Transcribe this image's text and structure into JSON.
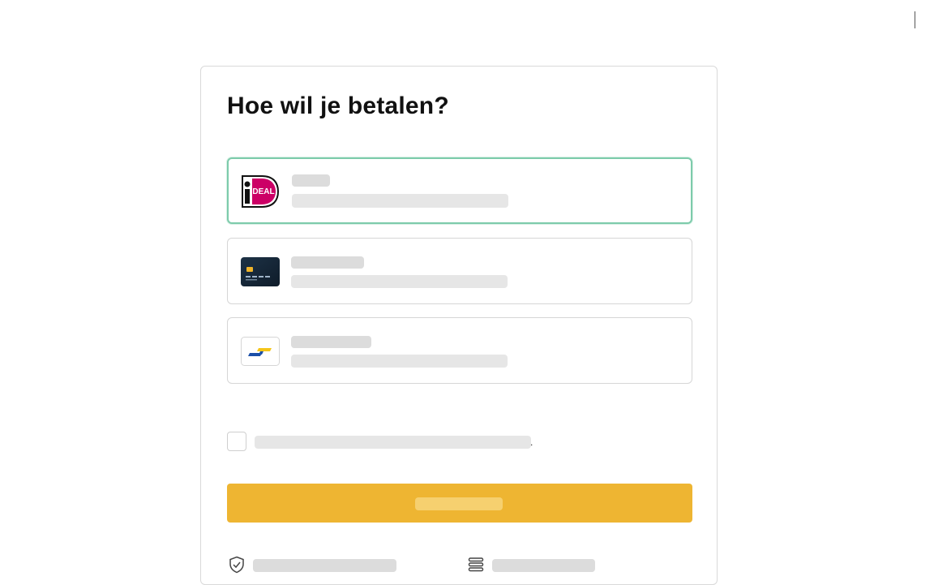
{
  "page": {
    "title": "Hoe wil je betalen?"
  },
  "payment_options": [
    {
      "id": "ideal",
      "icon": "ideal-logo-icon",
      "selected": true
    },
    {
      "id": "card",
      "icon": "credit-card-icon",
      "selected": false
    },
    {
      "id": "transfer",
      "icon": "bank-transfer-icon",
      "selected": false
    }
  ],
  "terms": {
    "checked": false,
    "suffix": "."
  },
  "footer": {
    "items": [
      {
        "icon": "shield-check-icon"
      },
      {
        "icon": "stack-lines-icon"
      }
    ]
  },
  "colors": {
    "selected_border": "#7dcbab",
    "button": "#eeb532",
    "skeleton": "#e6e6e6"
  }
}
